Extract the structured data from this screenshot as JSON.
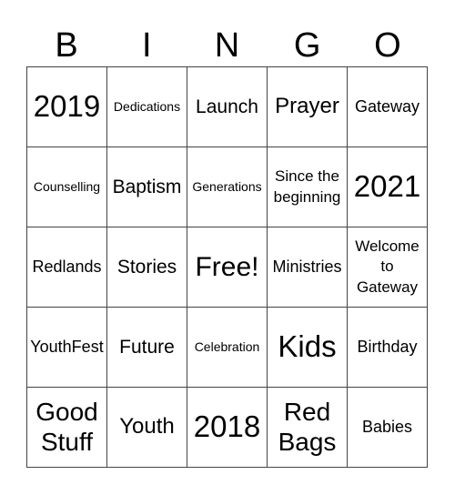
{
  "header": [
    "B",
    "I",
    "N",
    "G",
    "O"
  ],
  "cells": [
    {
      "text": "2019",
      "size": "s-xl"
    },
    {
      "text": "Dedications",
      "size": "s-xs"
    },
    {
      "text": "Launch",
      "size": "s-m"
    },
    {
      "text": "Prayer",
      "size": "s-l"
    },
    {
      "text": "Gateway",
      "size": "s-s"
    },
    {
      "text": "Counselling",
      "size": "s-xs"
    },
    {
      "text": "Baptism",
      "size": "s-m"
    },
    {
      "text": "Generations",
      "size": "s-xs"
    },
    {
      "text": "Since the beginning",
      "size": "s-three"
    },
    {
      "text": "2021",
      "size": "s-xl"
    },
    {
      "text": "Redlands",
      "size": "s-s"
    },
    {
      "text": "Stories",
      "size": "s-m"
    },
    {
      "text": "Free!",
      "size": "s-free"
    },
    {
      "text": "Ministries",
      "size": "s-s"
    },
    {
      "text": "Welcome to Gateway",
      "size": "s-three"
    },
    {
      "text": "YouthFest",
      "size": "s-s"
    },
    {
      "text": "Future",
      "size": "s-m"
    },
    {
      "text": "Celebration",
      "size": "s-xs"
    },
    {
      "text": "Kids",
      "size": "s-xl"
    },
    {
      "text": "Birthday",
      "size": "s-s"
    },
    {
      "text": "Good Stuff",
      "size": "s-two"
    },
    {
      "text": "Youth",
      "size": "s-l"
    },
    {
      "text": "2018",
      "size": "s-xl"
    },
    {
      "text": "Red Bags",
      "size": "s-two"
    },
    {
      "text": "Babies",
      "size": "s-s"
    }
  ]
}
